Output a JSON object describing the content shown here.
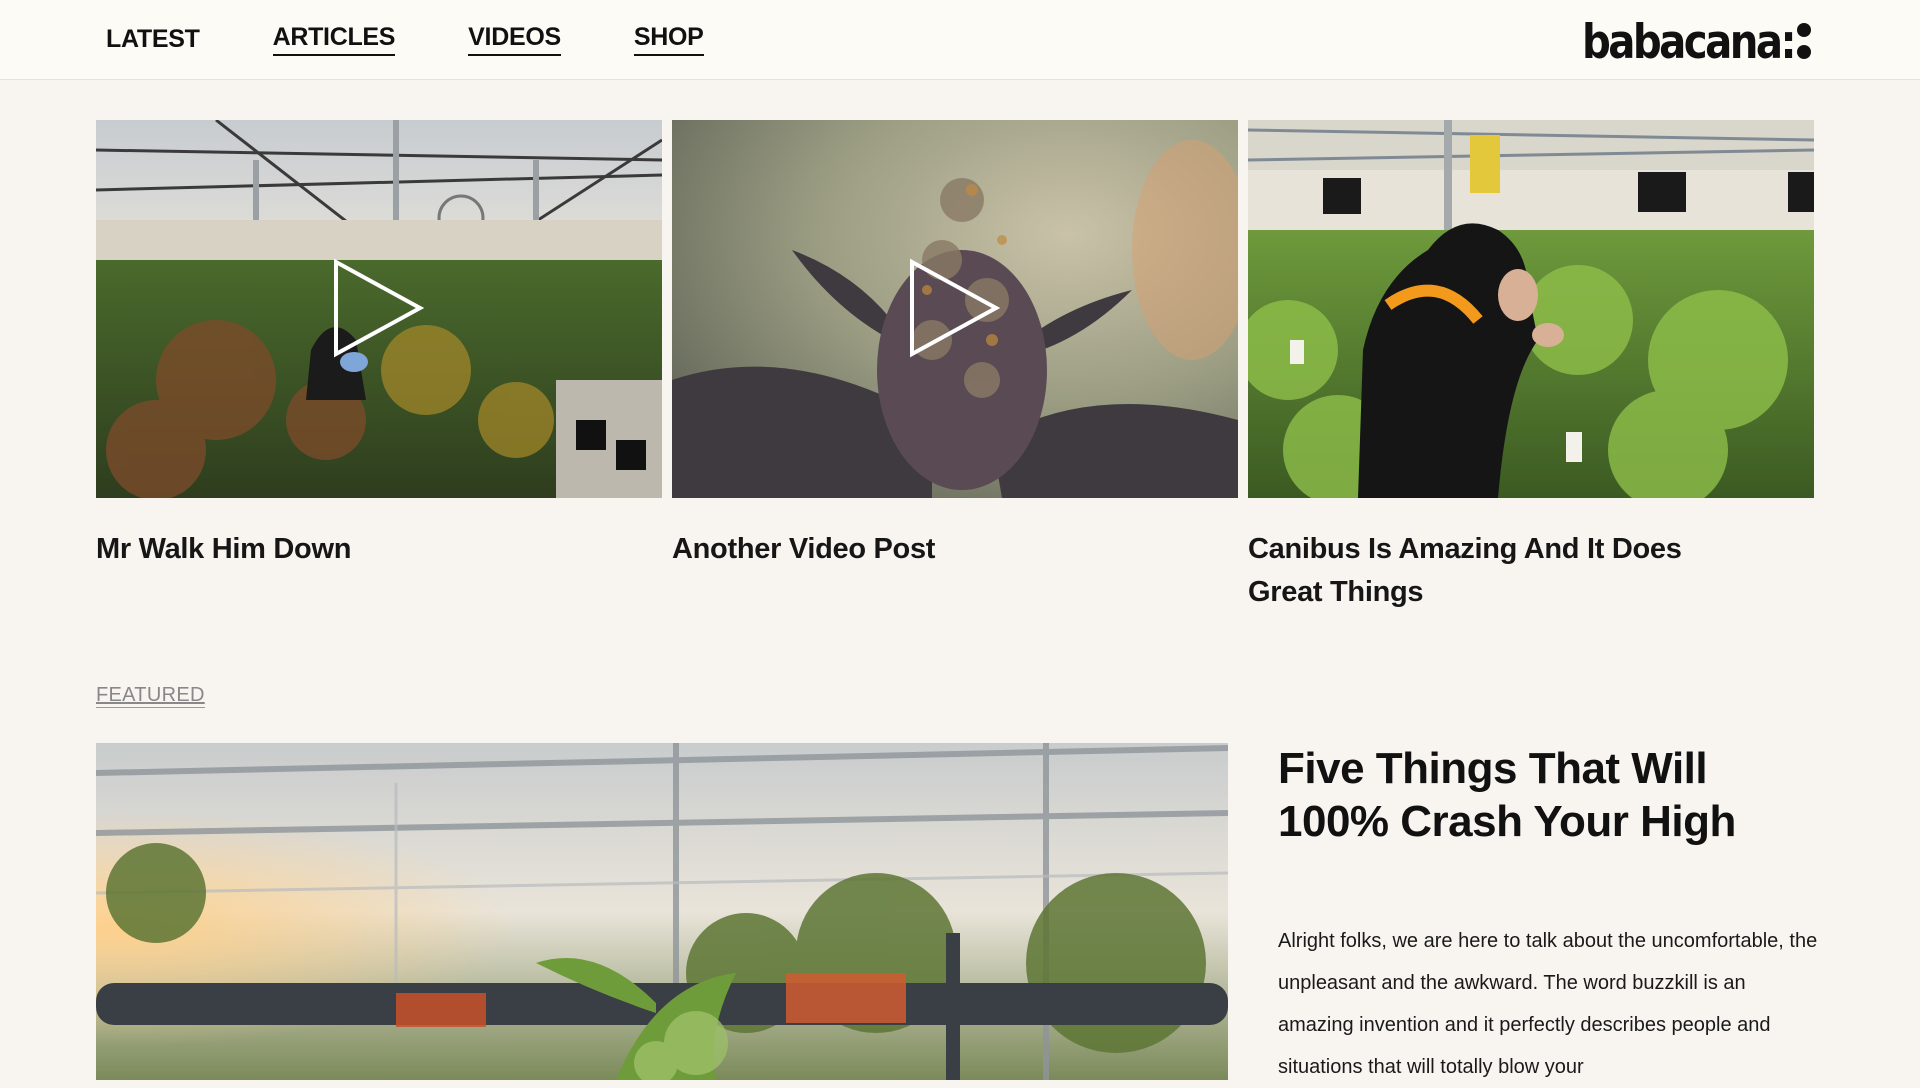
{
  "nav": {
    "items": [
      {
        "label": "LATEST"
      },
      {
        "label": "ARTICLES"
      },
      {
        "label": "VIDEOS"
      },
      {
        "label": "SHOP"
      }
    ]
  },
  "brand": {
    "logo_text": "babacana:"
  },
  "video_cards": [
    {
      "title": "Mr Walk Him Down",
      "icon": "play-icon"
    },
    {
      "title": "Another Video Post",
      "icon": "play-icon"
    },
    {
      "title": "Canibus Is Amazing And It Does Great Things"
    }
  ],
  "featured": {
    "label": "FEATURED",
    "title": "Five Things That Will 100% Crash Your High",
    "excerpt": "Alright folks, we are here to talk about the uncomfortable, the unpleasant and the awkward. The word buzzkill is an amazing invention and it perfectly describes people and situations that will totally blow your"
  },
  "colors": {
    "page_bg": "#f8f5f0",
    "header_bg": "#fdfbf6",
    "text": "#111111",
    "muted": "#888888"
  }
}
